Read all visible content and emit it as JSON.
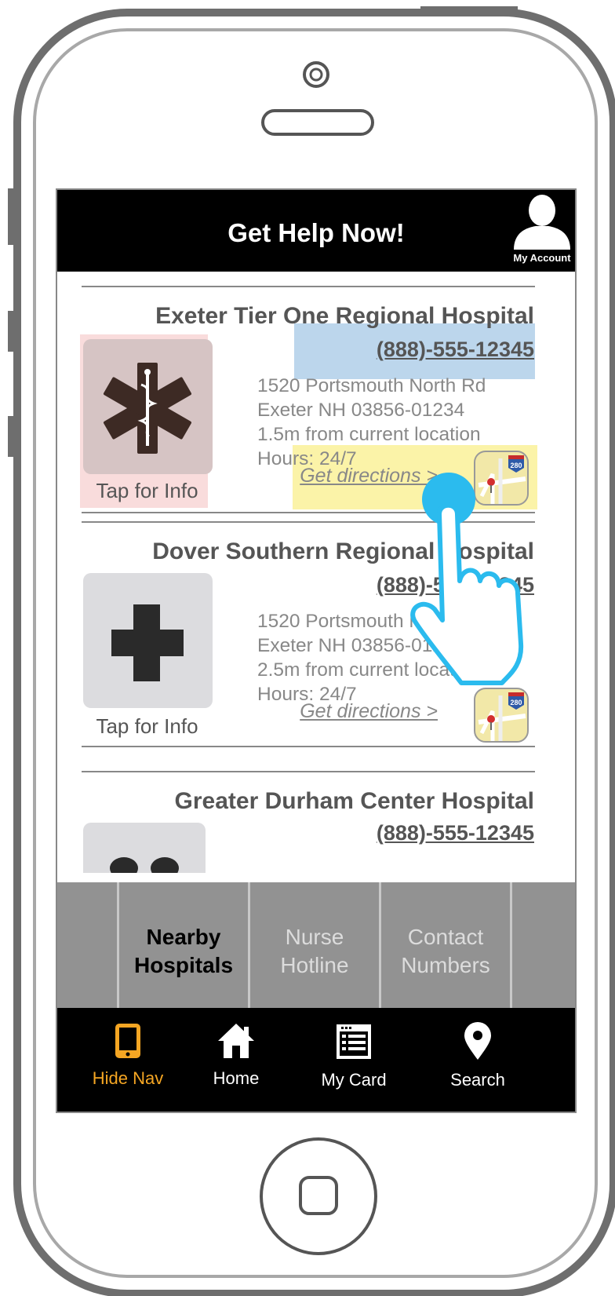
{
  "header": {
    "title": "Get Help Now!",
    "account_label": "My Account"
  },
  "hospitals": [
    {
      "name": "Exeter Tier One Regional Hospital",
      "phone": "(888)-555-12345",
      "address_line1": "1520 Portsmouth North Rd",
      "address_line2": "Exeter NH 03856-01234",
      "distance": "1.5m from current location",
      "hours": "Hours: 24/7",
      "directions": "Get directions >",
      "tap_label": "Tap for Info",
      "icon": "star-of-life-icon"
    },
    {
      "name": "Dover Southern Regional Hospital",
      "phone": "(888)-555-12345",
      "address_line1": "1520 Portsmouth North Rd",
      "address_line2": "Exeter NH 03856-01234",
      "distance": "2.5m from current location",
      "hours": "Hours: 24/7",
      "directions": "Get directions >",
      "tap_label": "Tap for Info",
      "icon": "medical-cross-icon"
    },
    {
      "name": "Greater Durham Center Hospital",
      "phone": "(888)-555-12345",
      "icon": "hospital-icon"
    }
  ],
  "map_badge": "280",
  "subnav": {
    "items": [
      {
        "line1": "Nearby",
        "line2": "Hospitals",
        "active": true
      },
      {
        "line1": "Nurse",
        "line2": "Hotline",
        "active": false
      },
      {
        "line1": "Contact",
        "line2": "Numbers",
        "active": false
      }
    ]
  },
  "tabs": [
    {
      "label": "Hide Nav",
      "icon": "phone-icon",
      "active": true
    },
    {
      "label": "Home",
      "icon": "home-icon",
      "active": false
    },
    {
      "label": "My Card",
      "icon": "card-icon",
      "active": false
    },
    {
      "label": "Search",
      "icon": "location-pin-icon",
      "active": false
    }
  ],
  "colors": {
    "accent": "#f5a623",
    "header_bg": "#000000",
    "subnav_bg": "#929292",
    "touch_dot": "#2bbbee"
  }
}
